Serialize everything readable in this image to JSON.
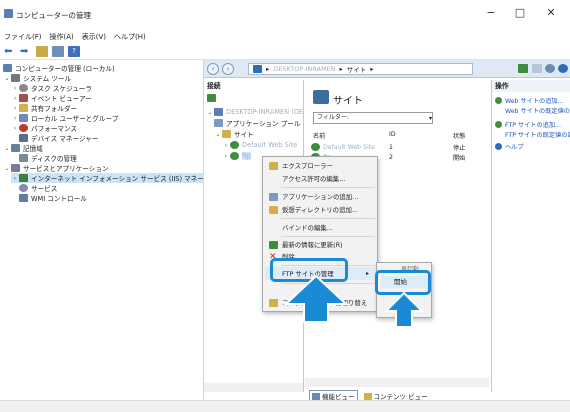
{
  "window": {
    "title": "コンピューターの管理",
    "controls": [
      "−",
      "□",
      "✕"
    ]
  },
  "menu": [
    "ファイル(F)",
    "操作(A)",
    "表示(V)",
    "ヘルプ(H)"
  ],
  "tree": {
    "root": "コンピューターの管理 (ローカル)",
    "system_tools": "システム ツール",
    "task_scheduler": "タスク スケジューラ",
    "event_viewer": "イベント ビューアー",
    "shared_folders": "共有フォルダー",
    "local_users": "ローカル ユーザーとグループ",
    "performance": "パフォーマンス",
    "device_manager": "デバイス マネージャー",
    "storage": "記憶域",
    "disk_management": "ディスクの管理",
    "services_apps": "サービスとアプリケーション",
    "iis_manager": "インターネット インフォメーション サービス (IIS) マネージャー",
    "services": "サービス",
    "wmi": "WMI コントロール"
  },
  "iis": {
    "address": {
      "host": "DESKTOP-INRAMEN",
      "sites": "サイト"
    },
    "connections": {
      "header": "接続",
      "server": "DESKTOP-INRAMEN (DE",
      "app_pools": "アプリケーション プール",
      "sites": "サイト",
      "default_site": "Default Web Site",
      "ftp_site": "ftp"
    },
    "center": {
      "title": "サイト",
      "filter_label": "フィルター:",
      "columns": [
        "名前",
        "ID",
        "状態"
      ],
      "rows": [
        {
          "name": "Default Web Site",
          "id": "1",
          "status": "停止"
        },
        {
          "name": "ftp",
          "id": "2",
          "status": "開始"
        }
      ]
    },
    "actions": {
      "header": "操作",
      "items": [
        "Web サイトの追加...",
        "Web サイトの既定値の設定...",
        "FTP サイトの追加...",
        "FTP サイトの既定値の設定...",
        "ヘルプ"
      ]
    },
    "view_tabs": [
      "機能ビュー",
      "コンテンツ ビュー"
    ]
  },
  "context_menu": {
    "items": [
      "エクスプローラー",
      "アクセス許可の編集...",
      "アプリケーションの追加...",
      "仮想ディレクトリの追加...",
      "バインドの編集...",
      "最新の情報に更新(R)",
      "削除",
      "FTP サイトの管理",
      "コンテンツ ビューに切り替え"
    ],
    "submenu": {
      "hidden_item": "再起動",
      "start": "開始",
      "stop": "停止"
    }
  },
  "colors": {
    "highlight": "#1a8ad6",
    "selection": "#cce4f7",
    "link": "#1a56b8"
  }
}
